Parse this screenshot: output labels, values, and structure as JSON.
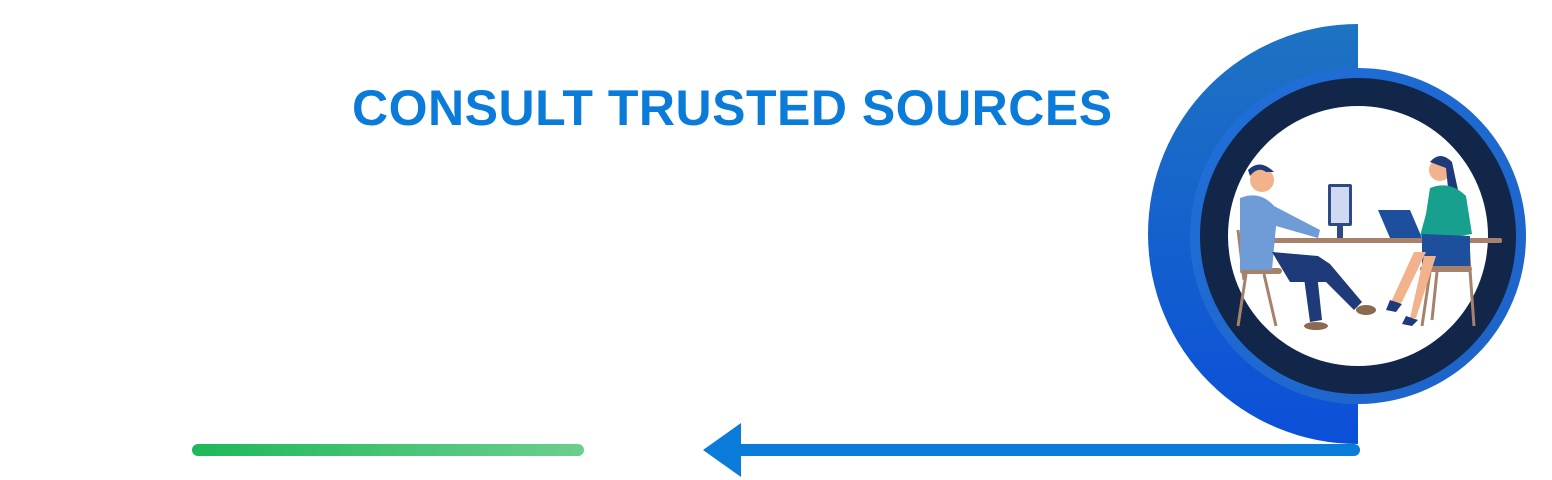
{
  "header": {
    "title": "CONSULT TRUSTED SOURCES"
  },
  "illustration": {
    "icon": "consultation-illustration-icon",
    "scene": "two-people-at-desk"
  },
  "colors": {
    "title": "#0a7bd8",
    "arrow": "#0a7bd8",
    "green_bar_start": "#1eb85a",
    "green_bar_end": "#6ccf8d",
    "ring_outer": "#1d6fc4",
    "ring_dark": "#12264a",
    "ring_accent": "#1a5fd6"
  },
  "arrow": {
    "direction": "left",
    "icon": "left-arrow-icon"
  }
}
